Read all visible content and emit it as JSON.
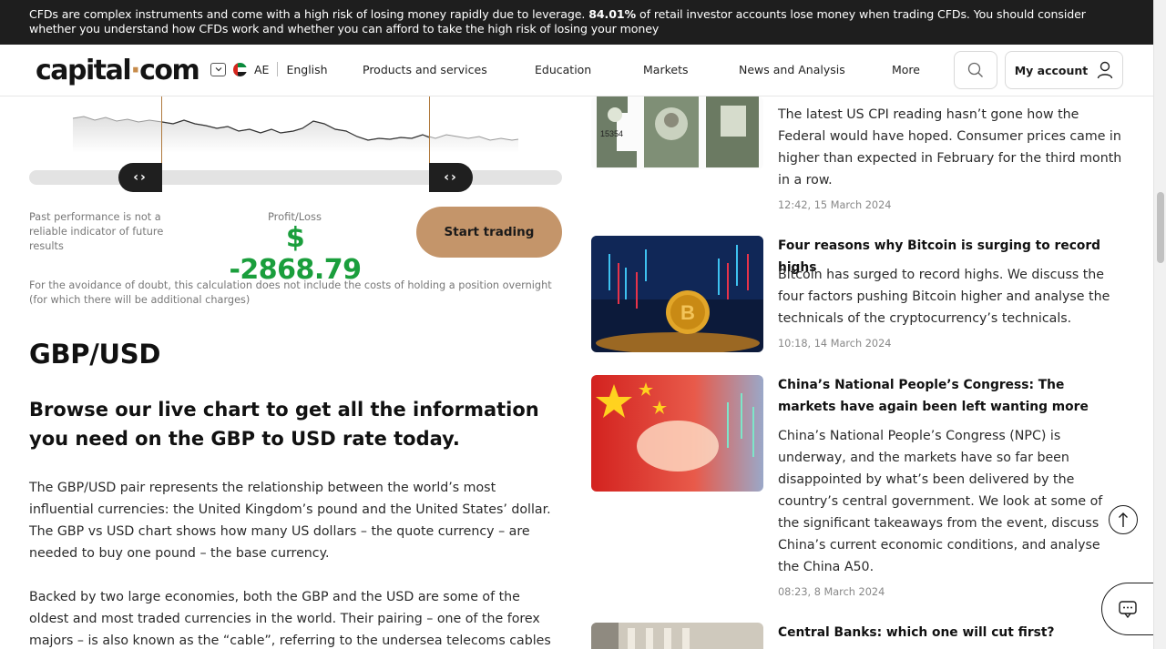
{
  "risk_banner": {
    "text_before": "CFDs are complex instruments and come with a high risk of losing money rapidly due to leverage. ",
    "percent": "84.01%",
    "text_after": " of retail investor accounts lose money when trading CFDs. You should consider whether you understand how CFDs work and whether you can afford to take the high risk of losing your money"
  },
  "header": {
    "logo_left": "capital",
    "logo_dot": "·",
    "logo_right": "com",
    "region": "AE",
    "language": "English",
    "nav": [
      "Products and services",
      "Education",
      "Markets",
      "News and Analysis",
      "More"
    ],
    "account_label": "My account"
  },
  "calculator": {
    "disclaimer": "Past performance is not a reliable indicator of future results",
    "pl_label": "Profit/Loss",
    "pl_value": "$ -2868.79",
    "start_button": "Start trading",
    "avoidance": "For the avoidance of doubt, this calculation does not include the costs of holding a position overnight (for which there will be additional charges)"
  },
  "article": {
    "title": "GBP/USD",
    "subtitle": "Browse our live chart to get all the information you need on the GBP to USD rate today.",
    "para1": "The GBP/USD pair represents the relationship between the world’s most influential currencies: the United Kingdom’s pound and the United States’ dollar. The GBP vs USD chart shows how many US dollars – the quote currency – are needed to buy one pound – the base currency.",
    "para2": "Backed by two large economies, both the GBP and the USD are some of the oldest and most traded currencies in the world. Their pairing – one of the forex majors – is also known as the “cable”, referring to the undersea telecoms cables"
  },
  "news": [
    {
      "title": "",
      "body": "The latest US CPI reading hasn’t gone how the Federal would have hoped. Consumer prices came in higher than expected in February for the third month in a row.",
      "date": "12:42, 15 March 2024",
      "image": "cpi-dollar-image"
    },
    {
      "title": "Four reasons why Bitcoin is surging to record highs",
      "body": "Bitcoin has surged to record highs. We discuss the four factors pushing Bitcoin higher and analyse the technicals of the cryptocurrency’s technicals.",
      "date": "10:18, 14 March 2024",
      "image": "bitcoin-image"
    },
    {
      "title": "China’s National People’s Congress: The markets have again been left wanting more",
      "body": "China’s National People’s Congress (NPC) is underway, and the markets have so far been disappointed by what’s been delivered by the country’s central government. We look at some of the significant takeaways from the event, discuss China’s current economic conditions, and analyse the China A50.",
      "date": "08:23, 8 March 2024",
      "image": "china-flag-image"
    },
    {
      "title": "Central Banks: which one will cut first?",
      "body": "",
      "date": "",
      "image": "bank-building-image"
    }
  ],
  "colors": {
    "accent": "#c4956a",
    "profit_loss": "#1a9e3c",
    "banner_bg": "#1e1e1e"
  }
}
